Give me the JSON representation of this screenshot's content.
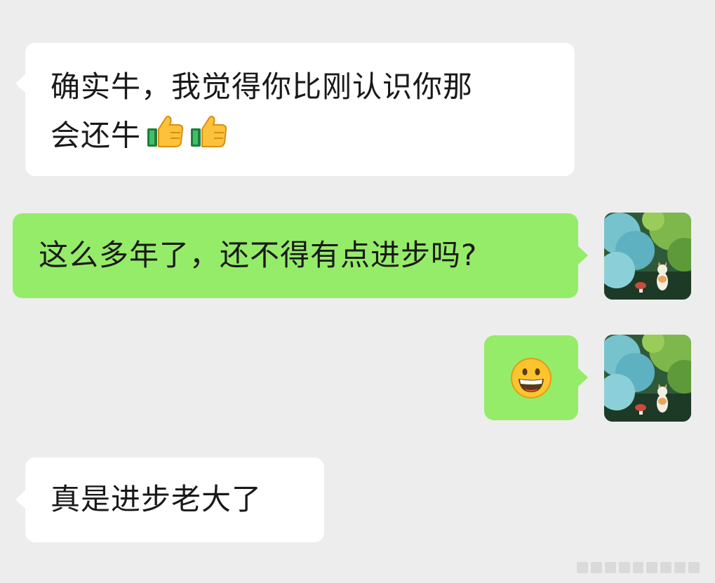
{
  "chat": {
    "messages": [
      {
        "direction": "received",
        "line1": "确实牛，我觉得你比刚认识你那",
        "line2": "会还牛",
        "emoji": "thumbs-up-emoji"
      },
      {
        "direction": "sent",
        "text": "这么多年了，还不得有点进步吗?",
        "avatar": "cat-forest-avatar"
      },
      {
        "direction": "sent",
        "emoji": "grinning-face-emoji",
        "avatar": "cat-forest-avatar"
      },
      {
        "direction": "received",
        "text": "真是进步老大了"
      }
    ]
  },
  "colors": {
    "background": "#ededed",
    "received_bubble": "#ffffff",
    "sent_bubble": "#95ec69",
    "text": "#191919"
  }
}
